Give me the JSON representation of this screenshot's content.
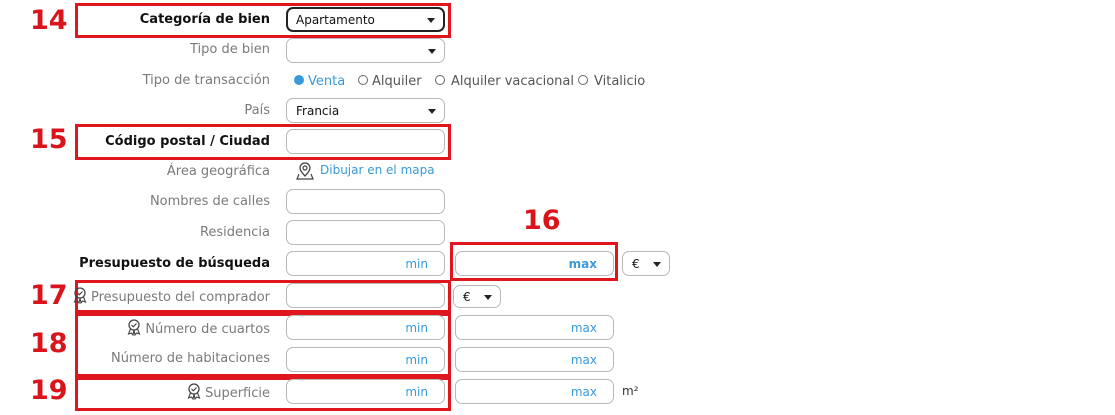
{
  "markers": [
    "14",
    "15",
    "16",
    "17",
    "18",
    "19"
  ],
  "form": {
    "categoria": {
      "label": "Categoría de bien",
      "value": "Apartamento"
    },
    "tipo": {
      "label": "Tipo de bien",
      "value": ""
    },
    "transaccion": {
      "label": "Tipo de transacción",
      "options": [
        "Venta",
        "Alquiler",
        "Alquiler vacacional",
        "Vitalicio"
      ],
      "selected": "Venta"
    },
    "pais": {
      "label": "País",
      "value": "Francia"
    },
    "postal": {
      "label": "Código postal / Ciudad",
      "value": ""
    },
    "area": {
      "label": "Área geográfica",
      "link": "Dibujar en el mapa"
    },
    "calles": {
      "label": "Nombres de calles",
      "value": ""
    },
    "residencia": {
      "label": "Residencia",
      "value": ""
    },
    "presupuesto": {
      "label": "Presupuesto de búsqueda",
      "min": "min",
      "max": "max",
      "currency": "€"
    },
    "comprador": {
      "label": "Presupuesto del comprador",
      "currency": "€"
    },
    "cuartos": {
      "label": "Número de cuartos",
      "min": "min",
      "max": "max"
    },
    "habitaciones": {
      "label": "Número de habitaciones",
      "min": "min",
      "max": "max"
    },
    "superficie": {
      "label": "Superficie",
      "min": "min",
      "max": "max",
      "unit": "m²"
    }
  },
  "colors": {
    "accent": "#3a9ad9",
    "highlight": "#e0161e"
  }
}
